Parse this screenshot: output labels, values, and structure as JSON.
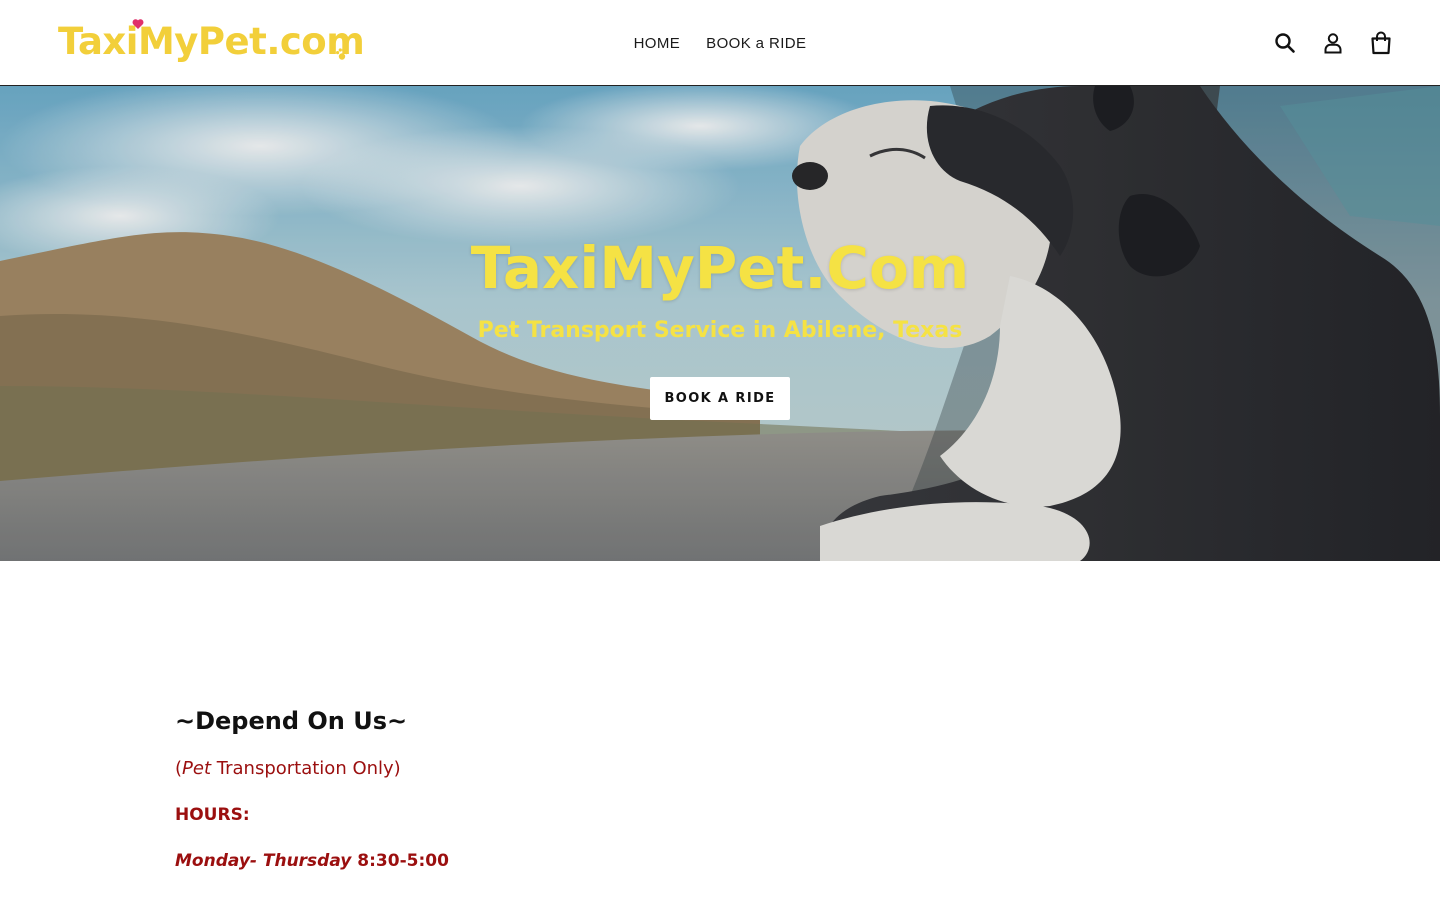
{
  "header": {
    "logo_text": "TaxiMyPet.com",
    "logo_heart_icon": "heart-icon",
    "logo_paw_icon": "paw-icon",
    "nav": [
      {
        "label": "HOME"
      },
      {
        "label": "BOOK a RIDE"
      }
    ],
    "icons": [
      "search-icon",
      "account-icon",
      "cart-icon"
    ]
  },
  "hero": {
    "title": "TaxiMyPet.Com",
    "subtitle": "Pet Transport Service in Abilene, Texas",
    "button_label": "BOOK A RIDE"
  },
  "content": {
    "heading": "~Depend On Us~",
    "note_open": "(",
    "note_italic": "Pet",
    "note_rest": " Transportation Only)",
    "hours_label": "HOURS:",
    "days_italic": "Monday- Thursday",
    "days_time": " 8:30-5:00"
  },
  "colors": {
    "brand_yellow": "#f5e244",
    "logo_yellow": "#f2cf3a",
    "heart_pink": "#e0306a",
    "accent_red": "#9b0f0f"
  }
}
